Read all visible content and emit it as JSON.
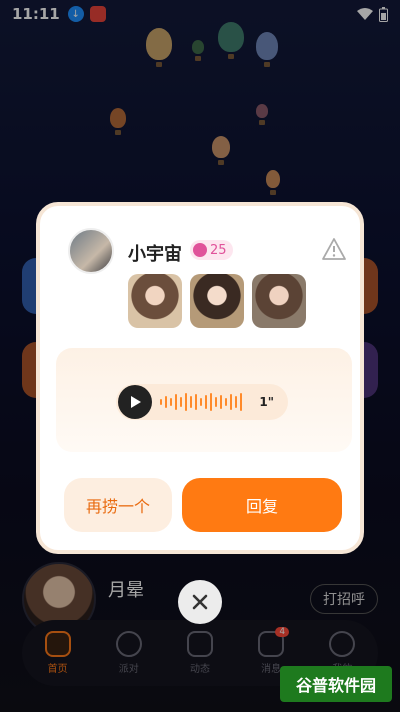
{
  "status_bar": {
    "time": "11:11"
  },
  "dialog": {
    "user_name": "小宇宙",
    "level": "25",
    "voice_duration": "1\"",
    "again_button": "再捞一个",
    "reply_button": "回复"
  },
  "list": {
    "name": "月晕",
    "greet_button": "打招呼"
  },
  "nav": {
    "items": [
      {
        "label": "首页",
        "icon": "home-icon"
      },
      {
        "label": "派对",
        "icon": "party-icon"
      },
      {
        "label": "动态",
        "icon": "moments-icon"
      },
      {
        "label": "消息",
        "icon": "message-icon",
        "badge": "4"
      },
      {
        "label": "我的",
        "icon": "profile-icon"
      }
    ]
  },
  "watermark": "谷普软件园",
  "colors": {
    "accent": "#ff7a12",
    "accent_light": "#fdeee0",
    "level_pink": "#e0529a"
  }
}
